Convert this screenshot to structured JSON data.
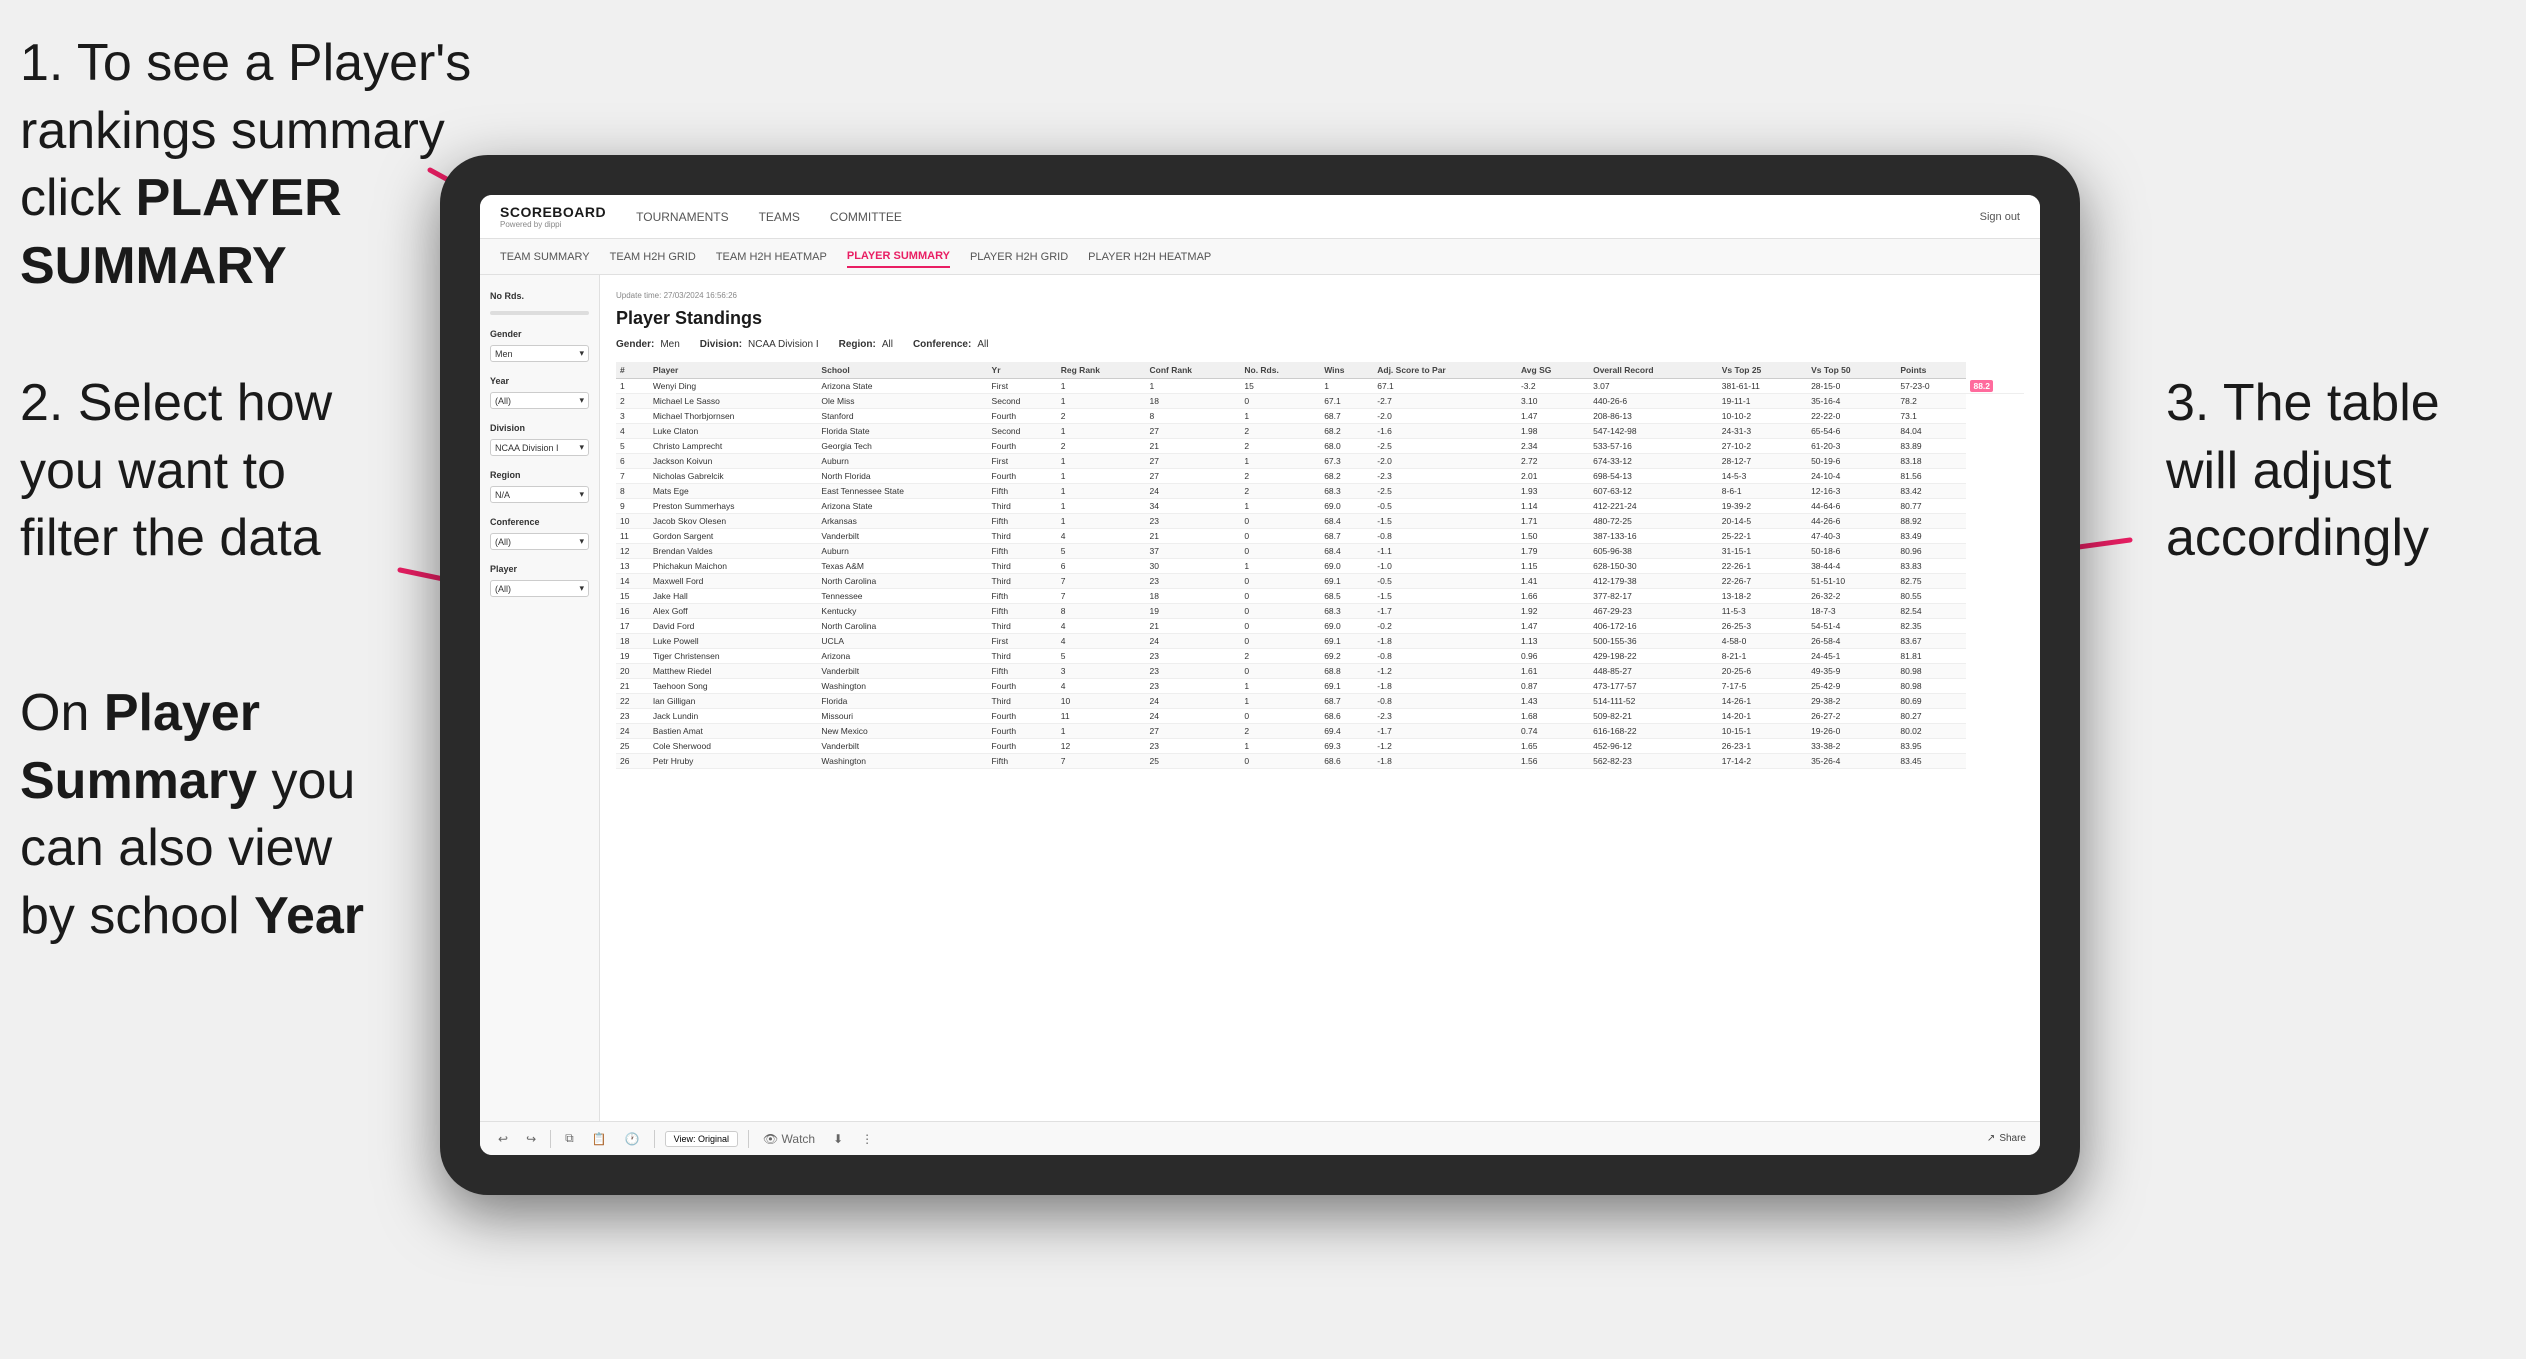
{
  "annotations": {
    "step1": {
      "number": "1.",
      "text": "To see a Player's rankings summary click ",
      "bold": "PLAYER SUMMARY"
    },
    "step2": {
      "text": "2. Select how you want to filter the data"
    },
    "step3_bottom": {
      "prefix": "On ",
      "bold1": "Player Summary",
      "middle": " you can also view by school ",
      "bold2": "Year"
    },
    "step3_right": {
      "text": "3. The table will adjust accordingly"
    }
  },
  "navbar": {
    "logo": "SCOREBOARD",
    "logo_sub": "Powered by dippi",
    "nav_items": [
      "TOURNAMENTS",
      "TEAMS",
      "COMMITTEE"
    ],
    "sign_out": "Sign out"
  },
  "sub_navbar": {
    "items": [
      "TEAM SUMMARY",
      "TEAM H2H GRID",
      "TEAM H2H HEATMAP",
      "PLAYER SUMMARY",
      "PLAYER H2H GRID",
      "PLAYER H2H HEATMAP"
    ]
  },
  "sidebar": {
    "no_rds_label": "No Rds.",
    "gender_label": "Gender",
    "gender_value": "Men",
    "year_label": "Year",
    "year_value": "(All)",
    "division_label": "Division",
    "division_value": "NCAA Division I",
    "region_label": "Region",
    "region_value": "N/A",
    "conference_label": "Conference",
    "conference_value": "(All)",
    "player_label": "Player",
    "player_value": "(All)"
  },
  "content": {
    "update_time": "Update time: 27/03/2024 16:56:26",
    "title": "Player Standings",
    "filters": {
      "gender": "Men",
      "division": "NCAA Division I",
      "region": "All",
      "conference": "All"
    },
    "table_headers": [
      "#",
      "Player",
      "School",
      "Yr",
      "Reg Rank",
      "Conf Rank",
      "No. Rds.",
      "Wins",
      "Adj. Score to Par",
      "Avg SG",
      "Overall Record",
      "Vs Top 25",
      "Vs Top 50",
      "Points"
    ],
    "rows": [
      [
        "1",
        "Wenyi Ding",
        "Arizona State",
        "First",
        "1",
        "1",
        "15",
        "1",
        "67.1",
        "-3.2",
        "3.07",
        "381-61-11",
        "28-15-0",
        "57-23-0",
        "88.2"
      ],
      [
        "2",
        "Michael Le Sasso",
        "Ole Miss",
        "Second",
        "1",
        "18",
        "0",
        "67.1",
        "-2.7",
        "3.10",
        "440-26-6",
        "19-11-1",
        "35-16-4",
        "78.2"
      ],
      [
        "3",
        "Michael Thorbjornsen",
        "Stanford",
        "Fourth",
        "2",
        "8",
        "1",
        "68.7",
        "-2.0",
        "1.47",
        "208-86-13",
        "10-10-2",
        "22-22-0",
        "73.1"
      ],
      [
        "4",
        "Luke Claton",
        "Florida State",
        "Second",
        "1",
        "27",
        "2",
        "68.2",
        "-1.6",
        "1.98",
        "547-142-98",
        "24-31-3",
        "65-54-6",
        "84.04"
      ],
      [
        "5",
        "Christo Lamprecht",
        "Georgia Tech",
        "Fourth",
        "2",
        "21",
        "2",
        "68.0",
        "-2.5",
        "2.34",
        "533-57-16",
        "27-10-2",
        "61-20-3",
        "83.89"
      ],
      [
        "6",
        "Jackson Koivun",
        "Auburn",
        "First",
        "1",
        "27",
        "1",
        "67.3",
        "-2.0",
        "2.72",
        "674-33-12",
        "28-12-7",
        "50-19-6",
        "83.18"
      ],
      [
        "7",
        "Nicholas Gabrelcik",
        "North Florida",
        "Fourth",
        "1",
        "27",
        "2",
        "68.2",
        "-2.3",
        "2.01",
        "698-54-13",
        "14-5-3",
        "24-10-4",
        "81.56"
      ],
      [
        "8",
        "Mats Ege",
        "East Tennessee State",
        "Fifth",
        "1",
        "24",
        "2",
        "68.3",
        "-2.5",
        "1.93",
        "607-63-12",
        "8-6-1",
        "12-16-3",
        "83.42"
      ],
      [
        "9",
        "Preston Summerhays",
        "Arizona State",
        "Third",
        "1",
        "34",
        "1",
        "69.0",
        "-0.5",
        "1.14",
        "412-221-24",
        "19-39-2",
        "44-64-6",
        "80.77"
      ],
      [
        "10",
        "Jacob Skov Olesen",
        "Arkansas",
        "Fifth",
        "1",
        "23",
        "0",
        "68.4",
        "-1.5",
        "1.71",
        "480-72-25",
        "20-14-5",
        "44-26-6",
        "88.92"
      ],
      [
        "11",
        "Gordon Sargent",
        "Vanderbilt",
        "Third",
        "4",
        "21",
        "0",
        "68.7",
        "-0.8",
        "1.50",
        "387-133-16",
        "25-22-1",
        "47-40-3",
        "83.49"
      ],
      [
        "12",
        "Brendan Valdes",
        "Auburn",
        "Fifth",
        "5",
        "37",
        "0",
        "68.4",
        "-1.1",
        "1.79",
        "605-96-38",
        "31-15-1",
        "50-18-6",
        "80.96"
      ],
      [
        "13",
        "Phichakun Maichon",
        "Texas A&M",
        "Third",
        "6",
        "30",
        "1",
        "69.0",
        "-1.0",
        "1.15",
        "628-150-30",
        "22-26-1",
        "38-44-4",
        "83.83"
      ],
      [
        "14",
        "Maxwell Ford",
        "North Carolina",
        "Third",
        "7",
        "23",
        "0",
        "69.1",
        "-0.5",
        "1.41",
        "412-179-38",
        "22-26-7",
        "51-51-10",
        "82.75"
      ],
      [
        "15",
        "Jake Hall",
        "Tennessee",
        "Fifth",
        "7",
        "18",
        "0",
        "68.5",
        "-1.5",
        "1.66",
        "377-82-17",
        "13-18-2",
        "26-32-2",
        "80.55"
      ],
      [
        "16",
        "Alex Goff",
        "Kentucky",
        "Fifth",
        "8",
        "19",
        "0",
        "68.3",
        "-1.7",
        "1.92",
        "467-29-23",
        "11-5-3",
        "18-7-3",
        "82.54"
      ],
      [
        "17",
        "David Ford",
        "North Carolina",
        "Third",
        "4",
        "21",
        "0",
        "69.0",
        "-0.2",
        "1.47",
        "406-172-16",
        "26-25-3",
        "54-51-4",
        "82.35"
      ],
      [
        "18",
        "Luke Powell",
        "UCLA",
        "First",
        "4",
        "24",
        "0",
        "69.1",
        "-1.8",
        "1.13",
        "500-155-36",
        "4-58-0",
        "26-58-4",
        "83.67"
      ],
      [
        "19",
        "Tiger Christensen",
        "Arizona",
        "Third",
        "5",
        "23",
        "2",
        "69.2",
        "-0.8",
        "0.96",
        "429-198-22",
        "8-21-1",
        "24-45-1",
        "81.81"
      ],
      [
        "20",
        "Matthew Riedel",
        "Vanderbilt",
        "Fifth",
        "3",
        "23",
        "0",
        "68.8",
        "-1.2",
        "1.61",
        "448-85-27",
        "20-25-6",
        "49-35-9",
        "80.98"
      ],
      [
        "21",
        "Taehoon Song",
        "Washington",
        "Fourth",
        "4",
        "23",
        "1",
        "69.1",
        "-1.8",
        "0.87",
        "473-177-57",
        "7-17-5",
        "25-42-9",
        "80.98"
      ],
      [
        "22",
        "Ian Gilligan",
        "Florida",
        "Third",
        "10",
        "24",
        "1",
        "68.7",
        "-0.8",
        "1.43",
        "514-111-52",
        "14-26-1",
        "29-38-2",
        "80.69"
      ],
      [
        "23",
        "Jack Lundin",
        "Missouri",
        "Fourth",
        "11",
        "24",
        "0",
        "68.6",
        "-2.3",
        "1.68",
        "509-82-21",
        "14-20-1",
        "26-27-2",
        "80.27"
      ],
      [
        "24",
        "Bastien Amat",
        "New Mexico",
        "Fourth",
        "1",
        "27",
        "2",
        "69.4",
        "-1.7",
        "0.74",
        "616-168-22",
        "10-15-1",
        "19-26-0",
        "80.02"
      ],
      [
        "25",
        "Cole Sherwood",
        "Vanderbilt",
        "Fourth",
        "12",
        "23",
        "1",
        "69.3",
        "-1.2",
        "1.65",
        "452-96-12",
        "26-23-1",
        "33-38-2",
        "83.95"
      ],
      [
        "26",
        "Petr Hruby",
        "Washington",
        "Fifth",
        "7",
        "25",
        "0",
        "68.6",
        "-1.8",
        "1.56",
        "562-82-23",
        "17-14-2",
        "35-26-4",
        "83.45"
      ]
    ]
  },
  "toolbar": {
    "view_label": "View: Original",
    "watch_label": "Watch",
    "share_label": "Share"
  }
}
